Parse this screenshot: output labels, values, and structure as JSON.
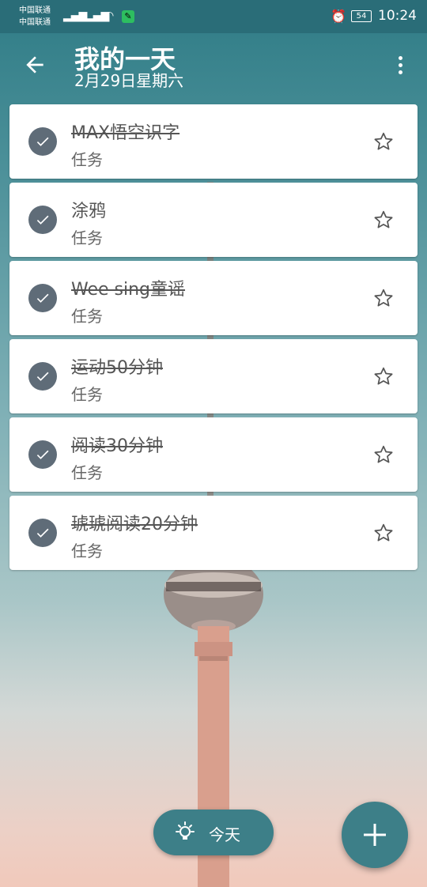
{
  "status": {
    "carrier1": "中国联通",
    "carrier2": "中国联通",
    "battery": "54",
    "time": "10:24",
    "icons": [
      "signal-icon",
      "wifi-icon",
      "evernote-icon",
      "alarm-icon",
      "battery-icon"
    ]
  },
  "header": {
    "title": "我的一天",
    "subtitle": "2月29日星期六",
    "back_icon": "arrow-left-icon",
    "more_icon": "more-vert-icon"
  },
  "tasks": [
    {
      "title": "MAX悟空识字",
      "subtitle": "任务",
      "completed": true,
      "starred": false
    },
    {
      "title": "涂鸦",
      "subtitle": "任务",
      "completed": true,
      "starred": false
    },
    {
      "title": "Wee sing童谣",
      "subtitle": "任务",
      "completed": true,
      "starred": false
    },
    {
      "title": "运动50分钟",
      "subtitle": "任务",
      "completed": true,
      "starred": false
    },
    {
      "title": "阅读30分钟",
      "subtitle": "任务",
      "completed": true,
      "starred": false
    },
    {
      "title": "琥琥阅读20分钟",
      "subtitle": "任务",
      "completed": true,
      "starred": false
    }
  ],
  "bottom": {
    "today_label": "今天",
    "today_icon": "lightbulb-icon",
    "add_icon": "plus-icon"
  },
  "colors": {
    "accent": "#3d7f88",
    "check": "#5f6c78",
    "statusbar": "#2a6d78"
  }
}
